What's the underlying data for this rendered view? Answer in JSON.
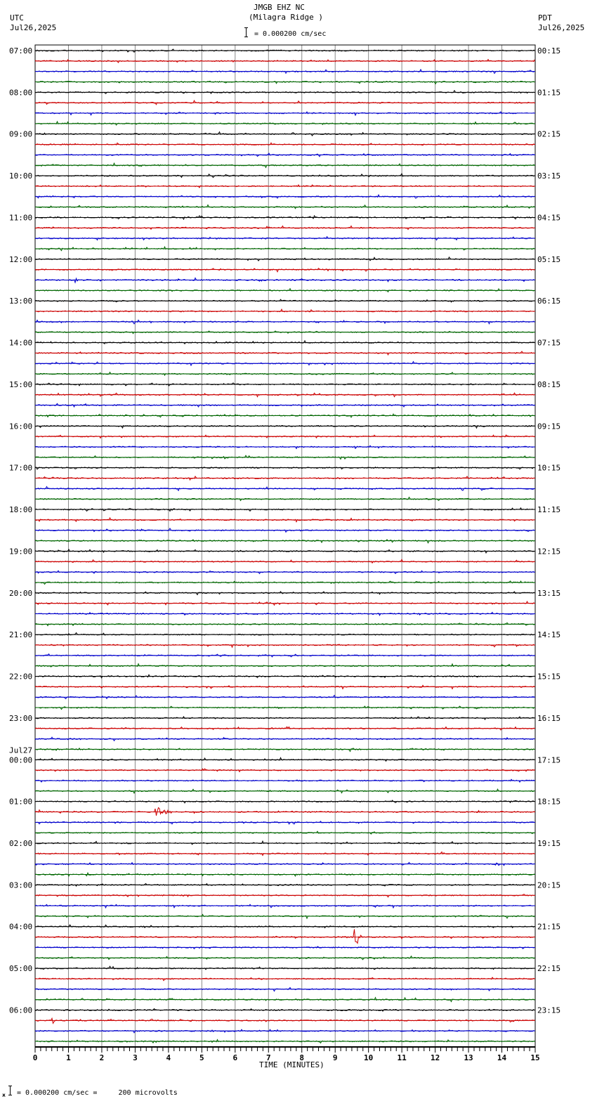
{
  "header": {
    "station": "JMGB EHZ NC",
    "location": "(Milagra Ridge )",
    "left_tz": "UTC",
    "left_date": "Jul26,2025",
    "right_tz": "PDT",
    "right_date": "Jul26,2025",
    "scale": "= 0.000200 cm/sec"
  },
  "footer": {
    "scale_note": "= 0.000200 cm/sec =     200 microvolts"
  },
  "chart_data": {
    "type": "line",
    "title": "JMGB EHZ NC (Milagra Ridge )",
    "xlabel": "TIME (MINUTES)",
    "xlim": [
      0,
      15
    ],
    "x_ticks": [
      "0",
      "1",
      "2",
      "3",
      "4",
      "5",
      "6",
      "7",
      "8",
      "9",
      "10",
      "11",
      "12",
      "13",
      "14",
      "15"
    ],
    "minutes_per_line": 15,
    "line_count": 96,
    "trace_colors": [
      "#000000",
      "#cc0000",
      "#0000cc",
      "#006600"
    ],
    "left_labels": [
      "07:00",
      "08:00",
      "09:00",
      "10:00",
      "11:00",
      "12:00",
      "13:00",
      "14:00",
      "15:00",
      "16:00",
      "17:00",
      "18:00",
      "19:00",
      "20:00",
      "21:00",
      "22:00",
      "23:00",
      "00:00",
      "01:00",
      "02:00",
      "03:00",
      "04:00",
      "05:00",
      "06:00"
    ],
    "date_change_label": "Jul27",
    "right_labels": [
      "00:15",
      "01:15",
      "02:15",
      "03:15",
      "04:15",
      "05:15",
      "06:15",
      "07:15",
      "08:15",
      "09:15",
      "10:15",
      "11:15",
      "12:15",
      "13:15",
      "14:15",
      "15:15",
      "16:15",
      "17:15",
      "18:15",
      "19:15",
      "20:15",
      "21:15",
      "22:15",
      "23:15"
    ],
    "events": [
      {
        "line": 73,
        "minute": 3.6,
        "amplitude": 8,
        "duration_min": 0.6
      },
      {
        "line": 85,
        "minute": 9.55,
        "amplitude": 14,
        "duration_min": 0.3
      },
      {
        "line": 93,
        "minute": 0.5,
        "amplitude": 6,
        "duration_min": 0.1
      },
      {
        "line": 93,
        "minute": 14.25,
        "amplitude": 5,
        "duration_min": 0.15
      },
      {
        "line": 4,
        "minute": 0.0,
        "amplitude": 1,
        "duration_min": 0.1
      },
      {
        "line": 16,
        "minute": 11.1,
        "amplitude": 5,
        "duration_min": 0.1
      },
      {
        "line": 22,
        "minute": 1.2,
        "amplitude": 5,
        "duration_min": 0.1
      }
    ]
  }
}
